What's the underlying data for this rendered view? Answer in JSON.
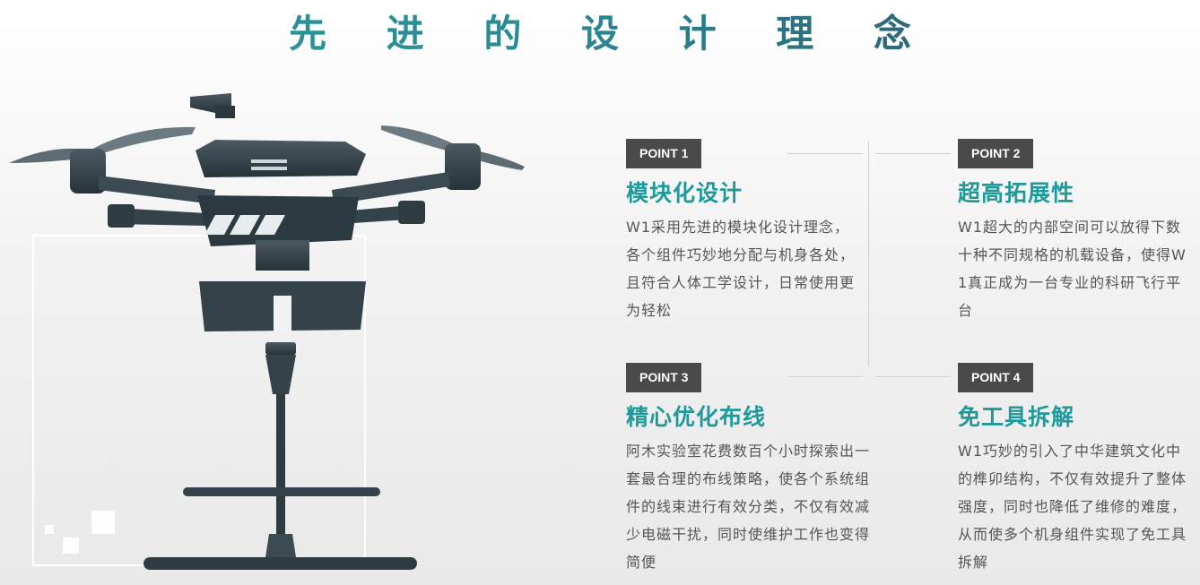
{
  "page": {
    "title": "先 进 的 设 计 理 念"
  },
  "points": [
    {
      "badge": "POINT 1",
      "title": "模块化设计",
      "desc": "W1采用先进的模块化设计理念，各个组件巧妙地分配与机身各处，且符合人体工学设计，日常使用更为轻松"
    },
    {
      "badge": "POINT 2",
      "title": "超高拓展性",
      "desc": "W1超大的内部空间可以放得下数十种不同规格的机载设备，使得W1真正成为一台专业的科研飞行平台"
    },
    {
      "badge": "POINT 3",
      "title": "精心优化布线",
      "desc": "阿木实验室花费数百个小时探索出一套最合理的布线策略，使各个系统组件的线束进行有效分类，不仅有效减少电磁干扰，同时使维护工作也变得简便"
    },
    {
      "badge": "POINT 4",
      "title": "免工具拆解",
      "desc": "W1巧妙的引入了中华建筑文化中的榫卯结构，不仅有效提升了整体强度，同时也降低了维修的难度，从而使多个机身组件实现了免工具拆解"
    }
  ],
  "colors": {
    "accent": "#1f9a9b",
    "badge_bg": "#4a4a4a",
    "drone": "#2f3d42"
  }
}
